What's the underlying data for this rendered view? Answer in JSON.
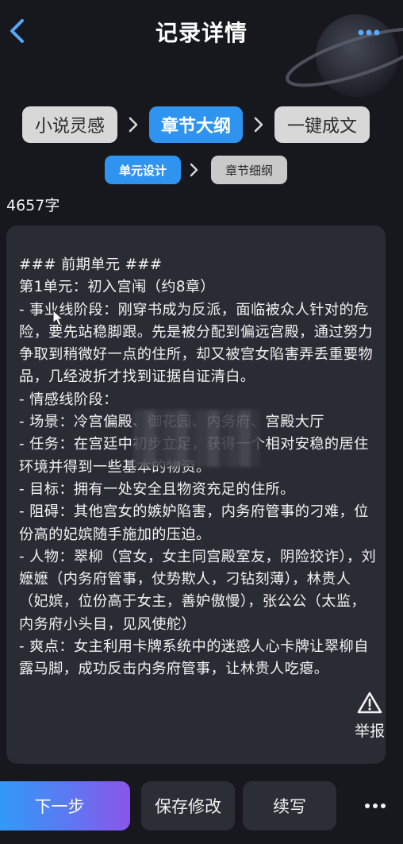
{
  "header": {
    "title": "记录详情",
    "back_icon": "chevron-left-icon",
    "more_icon": "more-dots-icon"
  },
  "steps": [
    {
      "label": "小说灵感",
      "state": "inactive"
    },
    {
      "label": "章节大纲",
      "state": "active"
    },
    {
      "label": "一键成文",
      "state": "inactive"
    }
  ],
  "sub_tabs": [
    {
      "label": "单元设计",
      "state": "active"
    },
    {
      "label": "章节细纲",
      "state": "inactive"
    }
  ],
  "word_count": "4657字",
  "content": {
    "text": "### 前期单元 ###\n第1单元：初入宫闱（约8章）\n- 事业线阶段：刚穿书成为反派，面临被众人针对的危险，要先站稳脚跟。先是被分配到偏远宫殿，通过努力争取到稍微好一点的住所，却又被宫女陷害弄丢重要物品，几经波折才找到证据自证清白。\n- 情感线阶段：\n- 场景：冷宫偏殿、御花园、内务府、宫殿大厅\n- 任务：在宫廷中初步立足，获得一个相对安稳的居住环境并得到一些基本的物资。\n- 目标：拥有一处安全且物资充足的住所。\n- 阻碍：其他宫女的嫉妒陷害，内务府管事的刁难，位份高的妃嫔随手施加的压迫。\n- 人物：翠柳（宫女，女主同宫殿室友，阴险狡诈），刘嬷嬷（内务府管事，仗势欺人，刁钻刻薄），林贵人（妃嫔，位份高于女主，善妒傲慢），张公公（太监，内务府小头目，见风使舵）\n- 爽点：女主利用卡牌系统中的迷惑人心卡牌让翠柳自露马脚，成功反击内务府管事，让林贵人吃瘪。"
  },
  "report": {
    "label": "举报",
    "icon": "warning-triangle-icon"
  },
  "bottom": {
    "next_label": "下一步",
    "save_label": "保存修改",
    "continue_label": "续写",
    "more_icon": "more-dots-icon"
  },
  "colors": {
    "background": "#17181e",
    "card": "#2a2c33",
    "accent": "#2f94f0",
    "inactive_chip": "#d8d8d8",
    "gradient_start": "#2aa0f6",
    "gradient_end": "#8a56ea"
  }
}
